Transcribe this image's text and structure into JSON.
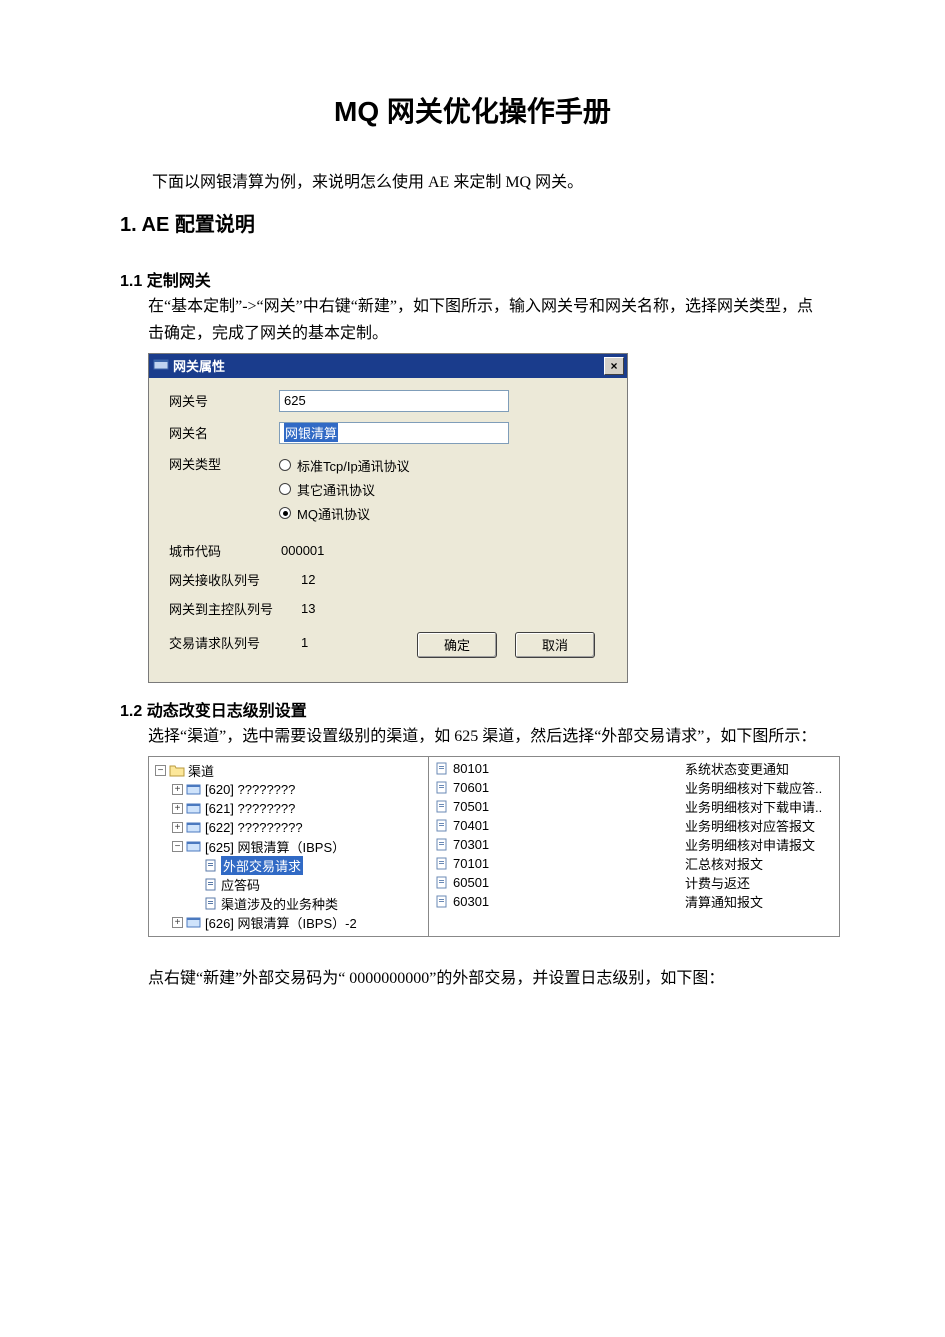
{
  "title": "MQ 网关优化操作手册",
  "intro": "下面以网银清算为例，来说明怎么使用 AE 来定制 MQ 网关。",
  "section1": {
    "heading": "1.  AE 配置说明",
    "s11": {
      "heading": "1.1 定制网关",
      "para": "在“基本定制”->“网关”中右键“新建”，如下图所示，输入网关号和网关名称，选择网关类型，点击确定，完成了网关的基本定制。"
    },
    "s12": {
      "heading": "1.2 动态改变日志级别设置",
      "para1": "选择“渠道”，选中需要设置级别的渠道，如 625 渠道，然后选择“外部交易请求”，如下图所示：",
      "para2": "点右键“新建”外部交易码为“ 0000000000”的外部交易，并设置日志级别，如下图："
    }
  },
  "dialog": {
    "title": "网关属性",
    "close_x": "×",
    "labels": {
      "gwno": "网关号",
      "gwname": "网关名",
      "gwtype": "网关类型",
      "city": "城市代码",
      "recvq": "网关接收队列号",
      "masterq": "网关到主控队列号",
      "txreq": "交易请求队列号"
    },
    "values": {
      "gwno": "625",
      "gwname": "网银清算",
      "city": "000001",
      "recvq": "12",
      "masterq": "13",
      "txreq": "1"
    },
    "radios": {
      "tcp": "标准Tcp/Ip通讯协议",
      "other": "其它通讯协议",
      "mq": "MQ通讯协议"
    },
    "buttons": {
      "ok": "确定",
      "cancel": "取消"
    }
  },
  "tree": {
    "root": "渠道",
    "nodes": {
      "n620": "[620] ????????",
      "n621": "[621] ????????",
      "n622": "[622] ?????????",
      "n625": "[625] 网银清算（IBPS）",
      "n625a": "外部交易请求",
      "n625b": "应答码",
      "n625c": "渠道涉及的业务种类",
      "n626": "[626] 网银清算（IBPS）-2"
    }
  },
  "list": [
    {
      "code": "80101",
      "name": "系统状态变更通知"
    },
    {
      "code": "70601",
      "name": "业务明细核对下载应答.."
    },
    {
      "code": "70501",
      "name": "业务明细核对下载申请.."
    },
    {
      "code": "70401",
      "name": "业务明细核对应答报文"
    },
    {
      "code": "70301",
      "name": "业务明细核对申请报文"
    },
    {
      "code": "70101",
      "name": "汇总核对报文"
    },
    {
      "code": "60501",
      "name": "计费与返还"
    },
    {
      "code": "60301",
      "name": "清算通知报文"
    }
  ],
  "glyphs": {
    "plus": "+",
    "minus": "−"
  }
}
